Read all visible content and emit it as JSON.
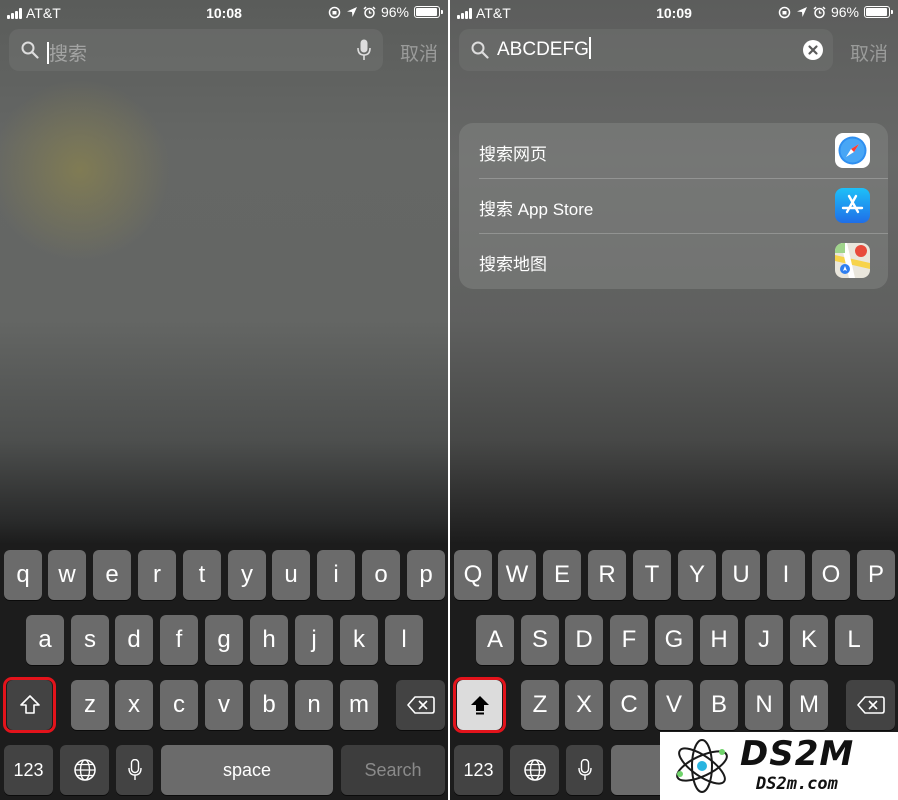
{
  "left": {
    "status": {
      "carrier": "AT&T",
      "time": "10:08",
      "battery": "96%"
    },
    "search": {
      "placeholder": "搜索",
      "cancel": "取消"
    },
    "keyboard": {
      "row1": [
        "q",
        "w",
        "e",
        "r",
        "t",
        "y",
        "u",
        "i",
        "o",
        "p"
      ],
      "row2": [
        "a",
        "s",
        "d",
        "f",
        "g",
        "h",
        "j",
        "k",
        "l"
      ],
      "row3": [
        "z",
        "x",
        "c",
        "v",
        "b",
        "n",
        "m"
      ],
      "numbers_key": "123",
      "space_key": "space",
      "search_key": "Search"
    }
  },
  "right": {
    "status": {
      "carrier": "AT&T",
      "time": "10:09",
      "battery": "96%"
    },
    "search": {
      "value": "ABCDEFG",
      "cancel": "取消"
    },
    "suggestions": [
      {
        "label": "搜索网页",
        "icon": "safari-icon"
      },
      {
        "label": "搜索 App Store",
        "icon": "app-store-icon"
      },
      {
        "label": "搜索地图",
        "icon": "maps-icon"
      }
    ],
    "keyboard": {
      "row1": [
        "Q",
        "W",
        "E",
        "R",
        "T",
        "Y",
        "U",
        "I",
        "O",
        "P"
      ],
      "row2": [
        "A",
        "S",
        "D",
        "F",
        "G",
        "H",
        "J",
        "K",
        "L"
      ],
      "row3": [
        "Z",
        "X",
        "C",
        "V",
        "B",
        "N",
        "M"
      ],
      "numbers_key": "123"
    }
  },
  "watermark": {
    "brand": "DS2M",
    "site": "DS2m.com"
  },
  "colors": {
    "highlight": "#e3131b",
    "key": "#6b6b6b",
    "key_dark": "#434343",
    "shift_active": "#dcdcdc"
  }
}
